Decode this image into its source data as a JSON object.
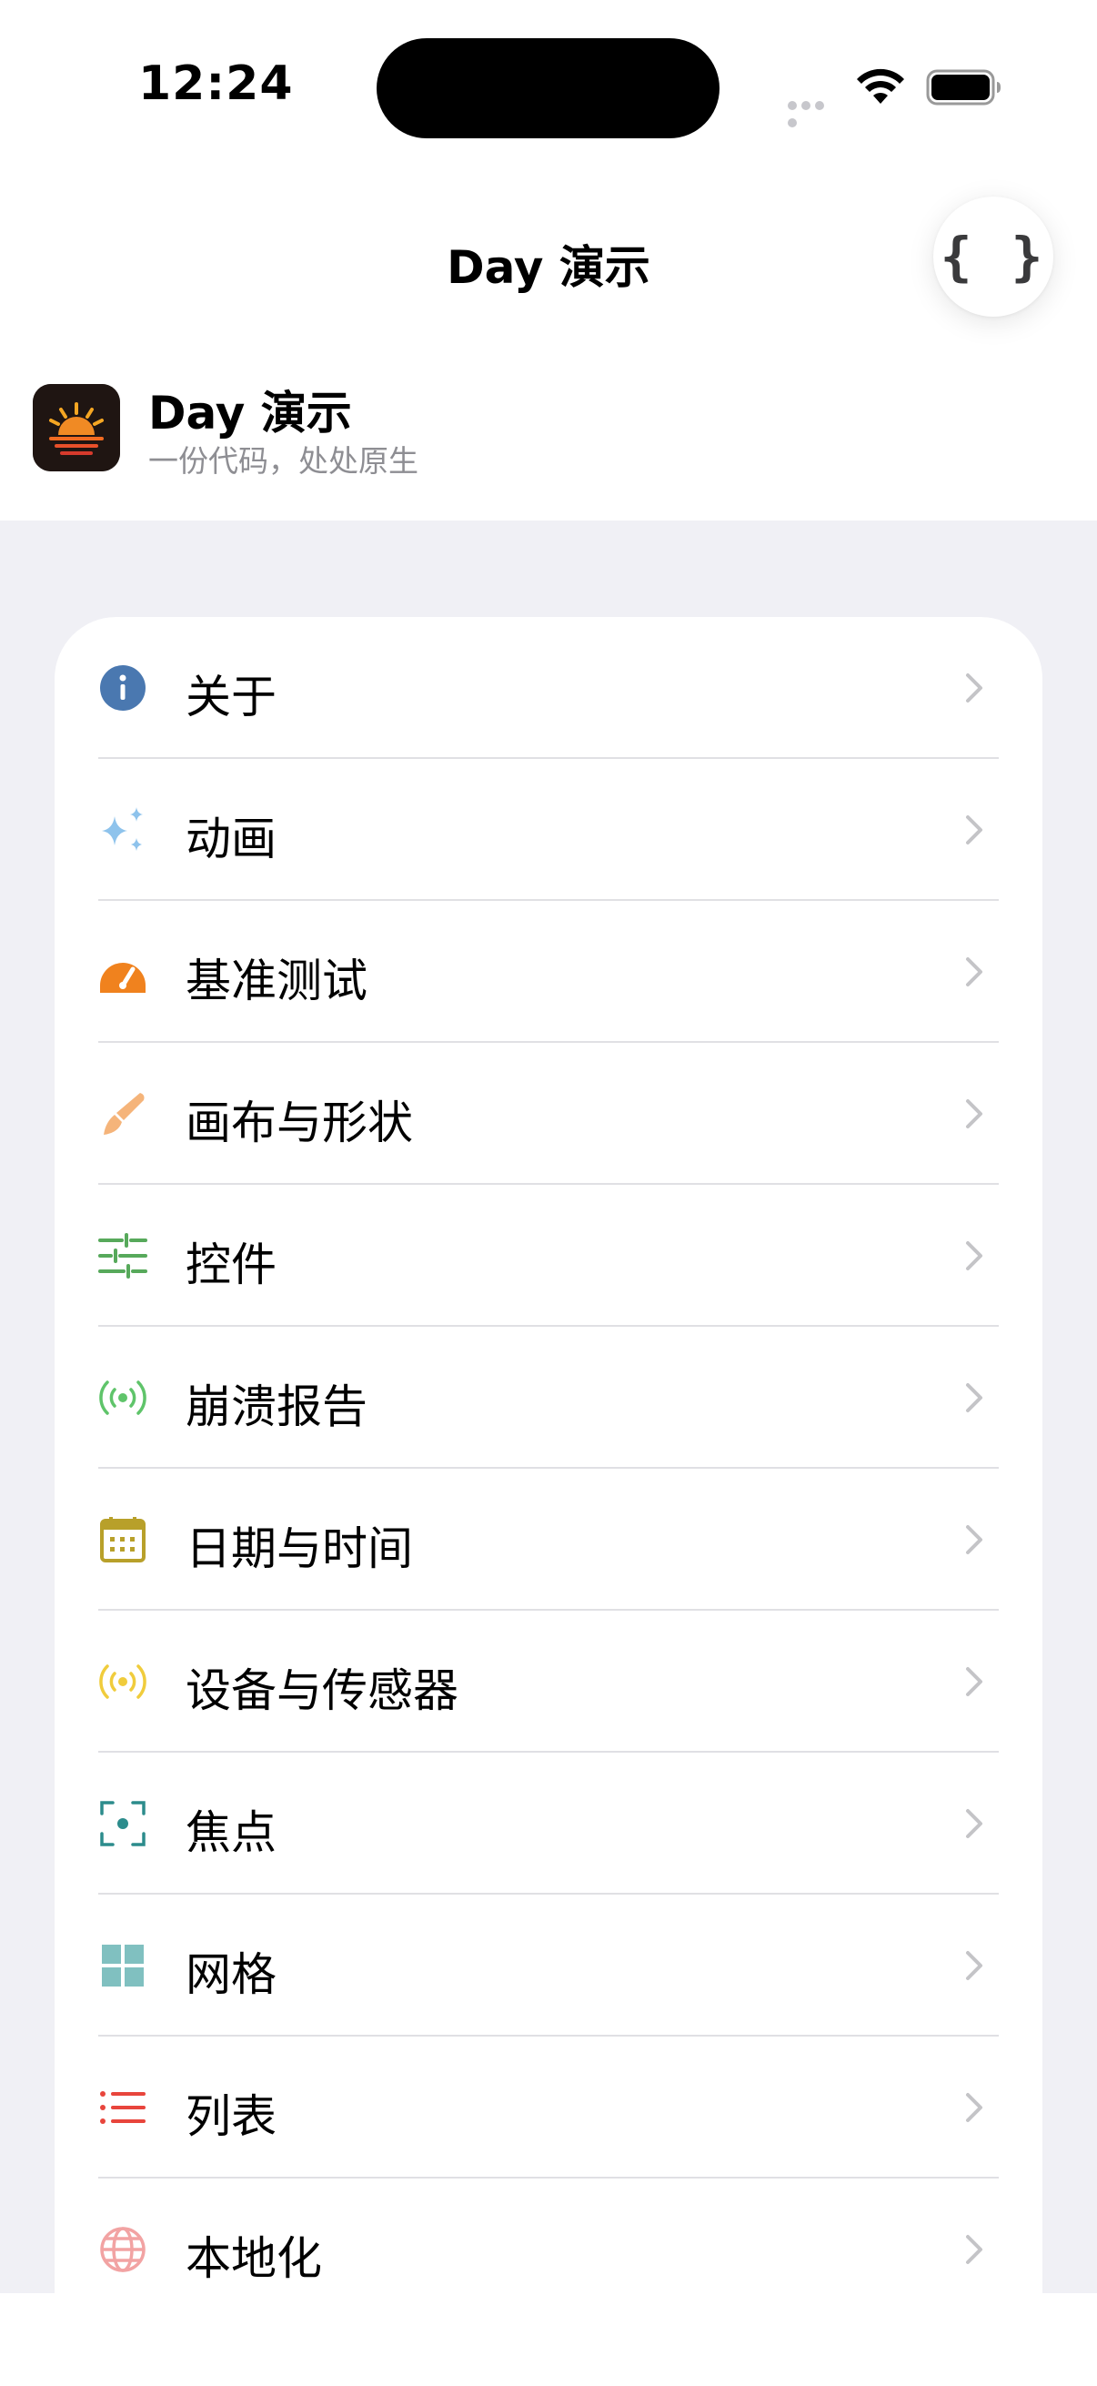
{
  "status_bar": {
    "time": "12:24"
  },
  "nav": {
    "title": "Day 演示",
    "code_button_glyph": "{ }"
  },
  "app": {
    "name": "Day 演示",
    "tagline": "一份代码，处处原生"
  },
  "menu": {
    "items": [
      {
        "label": "关于",
        "icon": "info-icon",
        "color": "#4a78b0"
      },
      {
        "label": "动画",
        "icon": "sparkles-icon",
        "color": "#8ec3ec"
      },
      {
        "label": "基准测试",
        "icon": "gauge-icon",
        "color": "#f0821e"
      },
      {
        "label": "画布与形状",
        "icon": "paintbrush-icon",
        "color": "#f5b47a"
      },
      {
        "label": "控件",
        "icon": "sliders-icon",
        "color": "#57a95b"
      },
      {
        "label": "崩溃报告",
        "icon": "broadcast-icon",
        "color": "#5fc46a"
      },
      {
        "label": "日期与时间",
        "icon": "calendar-icon",
        "color": "#b8a02a"
      },
      {
        "label": "设备与传感器",
        "icon": "sensor-icon",
        "color": "#f0cc3c"
      },
      {
        "label": "焦点",
        "icon": "focus-icon",
        "color": "#2c8c8c"
      },
      {
        "label": "网格",
        "icon": "grid-icon",
        "color": "#80c0c0"
      },
      {
        "label": "列表",
        "icon": "list-icon",
        "color": "#e8453c"
      },
      {
        "label": "本地化",
        "icon": "globe-icon",
        "color": "#f2a3a3"
      }
    ]
  }
}
